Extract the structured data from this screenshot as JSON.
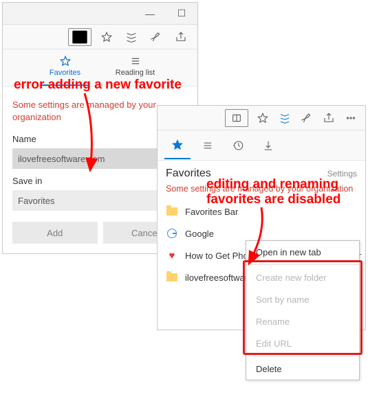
{
  "annotations": {
    "left": "error adding a new favorite",
    "right_line1": "editing and renaming",
    "right_line2": "favorites are disabled"
  },
  "panelA": {
    "tabs": {
      "favorites": "Favorites",
      "reading_list": "Reading list"
    },
    "managed_msg": "Some settings are managed by your organization",
    "name_label": "Name",
    "name_value": "ilovefreesoftware.com",
    "savein_label": "Save in",
    "savein_value": "Favorites",
    "add_btn": "Add",
    "cancel_btn": "Cancel"
  },
  "panelB": {
    "title": "Favorites",
    "settings": "Settings",
    "managed_msg": "Some settings are managed by your organization",
    "items": [
      {
        "label": "Favorites Bar",
        "icon": "folder"
      },
      {
        "label": "Google",
        "icon": "google"
      },
      {
        "label": "How to Get Phone",
        "icon": "heart",
        "extra": "oid for"
      },
      {
        "label": "ilovefreesoftware",
        "icon": "folder"
      }
    ],
    "ctx": {
      "open": "Open in new tab",
      "create": "Create new folder",
      "sort": "Sort by name",
      "rename": "Rename",
      "editurl": "Edit URL",
      "delete": "Delete"
    }
  }
}
